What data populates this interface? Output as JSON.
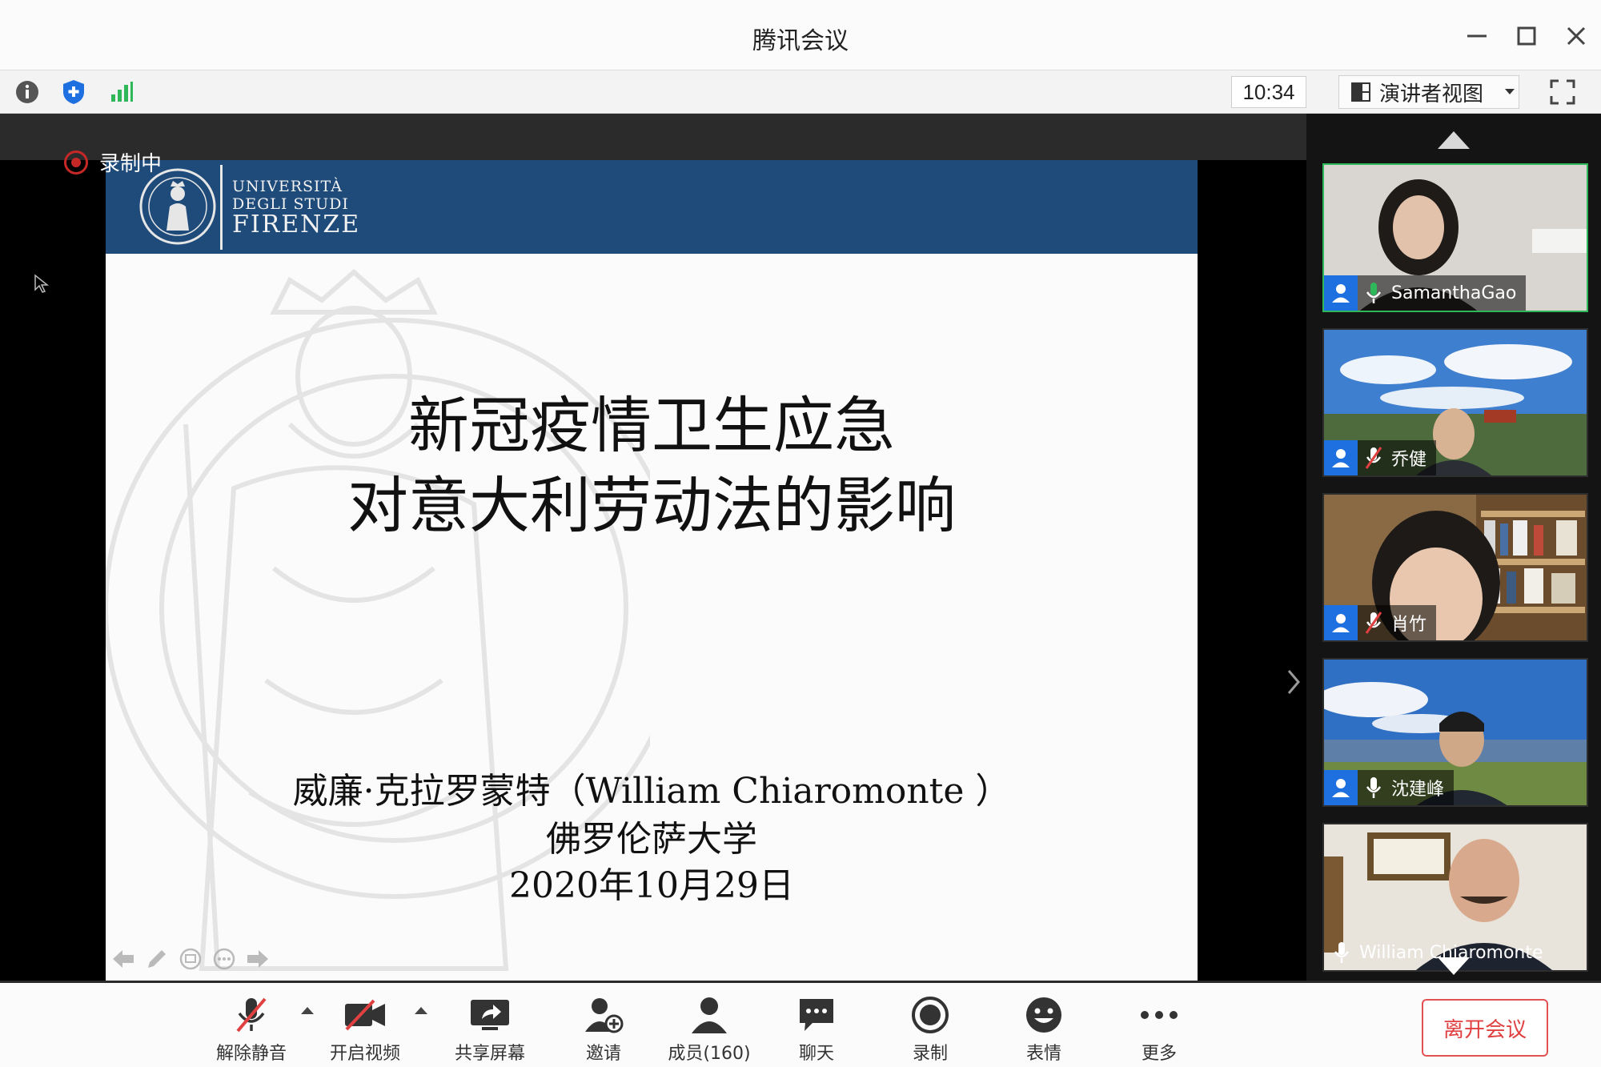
{
  "window": {
    "title": "腾讯会议"
  },
  "toolbar": {
    "time": "10:34",
    "view_label": "演讲者视图"
  },
  "stage": {
    "recording_label": "录制中"
  },
  "slide": {
    "university_line1": "UNIVERSITÀ",
    "university_line2": "DEGLI STUDI",
    "university_line3": "FIRENZE",
    "title_line1": "新冠疫情卫生应急",
    "title_line2": "对意大利劳动法的影响",
    "author": "威廉·克拉罗蒙特（William Chiaromonte ）",
    "affiliation": "佛罗伦萨大学",
    "date": "2020年10月29日"
  },
  "participants": [
    {
      "name": "SamanthaGao",
      "muted": false,
      "speaking": true
    },
    {
      "name": "乔健",
      "muted": true,
      "speaking": false
    },
    {
      "name": "肖竹",
      "muted": true,
      "speaking": false
    },
    {
      "name": "沈建峰",
      "muted": false,
      "speaking": false
    },
    {
      "name": "William Chiaromonte",
      "muted": false,
      "speaking": false
    }
  ],
  "controls": {
    "unmute": "解除静音",
    "video": "开启视频",
    "share": "共享屏幕",
    "invite": "邀请",
    "members": "成员(160)",
    "chat": "聊天",
    "record": "录制",
    "emoji": "表情",
    "more": "更多",
    "leave": "离开会议"
  },
  "colors": {
    "accent_blue": "#1e6fe0",
    "header_blue": "#1e4b7a",
    "speaking_green": "#2fb85a",
    "leave_red": "#e04040"
  }
}
